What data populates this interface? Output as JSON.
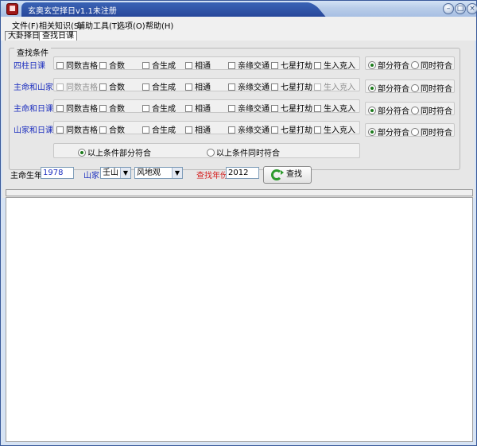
{
  "window": {
    "title": "玄奥玄空择日v1.1未注册",
    "icon": "app-seal-icon",
    "controls": [
      "minimize",
      "maximize",
      "close"
    ]
  },
  "menu": [
    "文件(F)",
    "相关知识(S)",
    "辅助工具(T)",
    "选项(O)",
    "帮助(H)"
  ],
  "tabs": [
    {
      "label": "大卦择日",
      "active": false
    },
    {
      "label": "查找日课",
      "active": true
    }
  ],
  "group": {
    "title": "查找条件",
    "rows": [
      {
        "label": "四柱日课",
        "options": [
          "同数吉格",
          "合数",
          "合生成",
          "相通",
          "亲缘交通",
          "七星打劫",
          "生入克入"
        ],
        "disabled": [],
        "match": [
          "部分符合",
          "同时符合"
        ],
        "selected": 0
      },
      {
        "label": "主命和山家",
        "options": [
          "同数吉格",
          "合数",
          "合生成",
          "相通",
          "亲缘交通",
          "七星打劫",
          "生入克入"
        ],
        "disabled": [
          0,
          6
        ],
        "match": [
          "部分符合",
          "同时符合"
        ],
        "selected": 0
      },
      {
        "label": "主命和日课",
        "options": [
          "同数吉格",
          "合数",
          "合生成",
          "相通",
          "亲缘交通",
          "七星打劫",
          "生入克入"
        ],
        "disabled": [],
        "match": [
          "部分符合",
          "同时符合"
        ],
        "selected": 0
      },
      {
        "label": "山家和日课",
        "options": [
          "同数吉格",
          "合数",
          "合生成",
          "相通",
          "亲缘交通",
          "七星打劫",
          "生入克入"
        ],
        "disabled": [],
        "match": [
          "部分符合",
          "同时符合"
        ],
        "selected": 0
      }
    ],
    "overall": {
      "options": [
        "以上条件部分符合",
        "以上条件同时符合"
      ],
      "selected": 0
    }
  },
  "search": {
    "birth_year_label": "主命生年",
    "birth_year_value": "1978",
    "mountain_label": "山家",
    "mountain_value": "壬山",
    "category_value": "风地观",
    "year_label": "查找年份",
    "year_value": "2012",
    "button_label": "查找"
  },
  "colors": {
    "accent_blue": "#1d2fbf",
    "year_label_red": "#d42020",
    "title_bar": "#27479a"
  }
}
